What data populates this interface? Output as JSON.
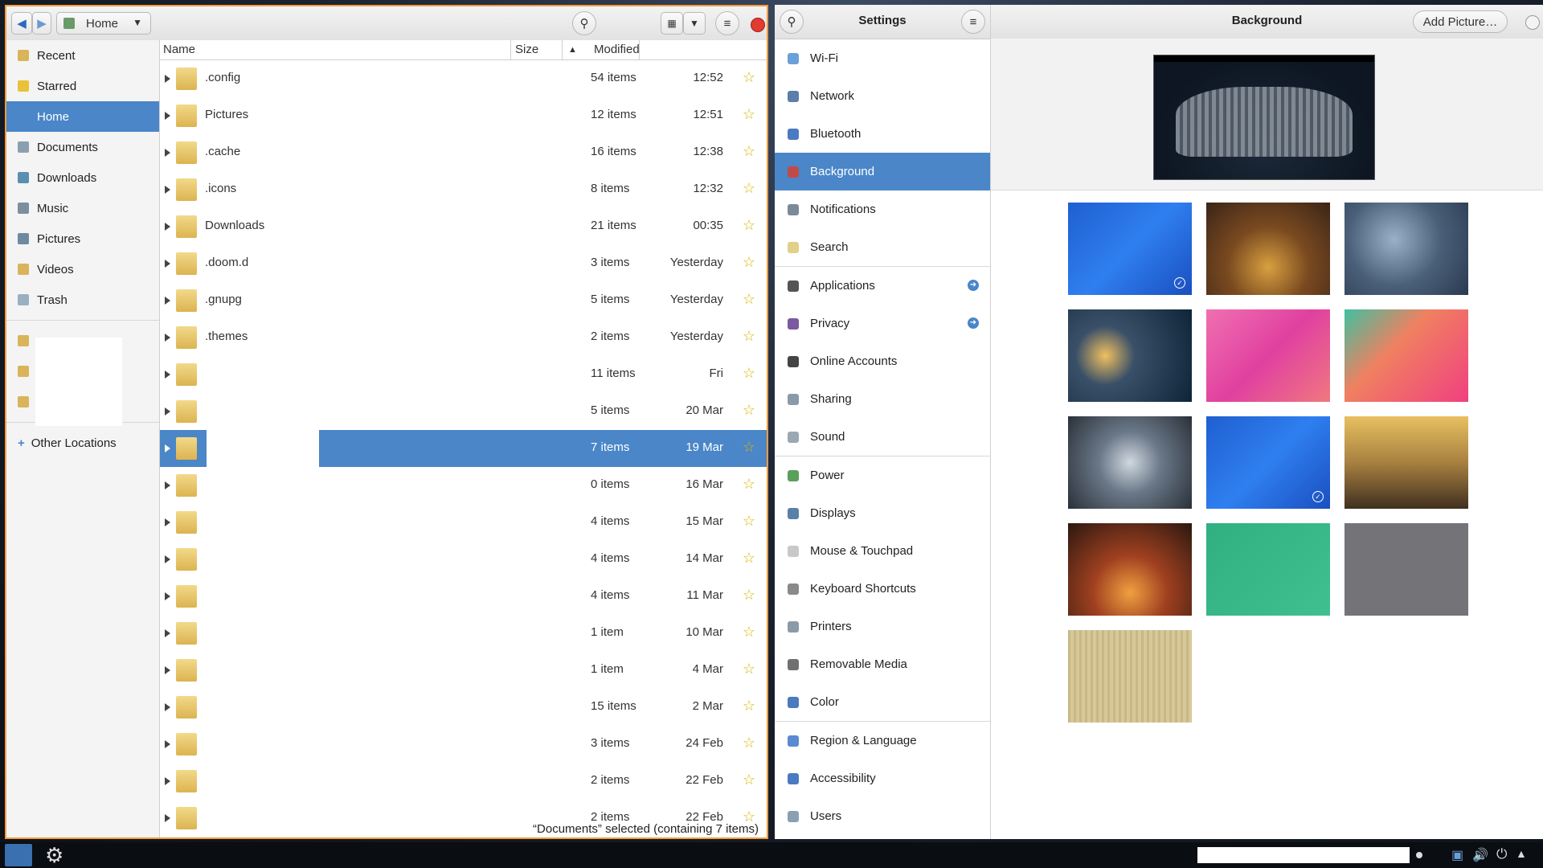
{
  "files": {
    "location": "Home",
    "columns": {
      "name": "Name",
      "size": "Size",
      "modified": "Modified"
    },
    "sidebar": [
      {
        "label": "Recent",
        "color": "#d9b45a"
      },
      {
        "label": "Starred",
        "color": "#e8c23a"
      },
      {
        "label": "Home",
        "color": "#4a86c8",
        "selected": true
      },
      {
        "label": "Documents",
        "color": "#8aa0b0"
      },
      {
        "label": "Downloads",
        "color": "#5a8fb0"
      },
      {
        "label": "Music",
        "color": "#7a8f9f"
      },
      {
        "label": "Pictures",
        "color": "#6f8aa0"
      },
      {
        "label": "Videos",
        "color": "#d9b45a"
      },
      {
        "label": "Trash",
        "color": "#9ab0c0"
      }
    ],
    "other_locations": "Other Locations",
    "rows": [
      {
        "name": ".config",
        "size": "54 items",
        "modified": "12:52"
      },
      {
        "name": "Pictures",
        "size": "12 items",
        "modified": "12:51"
      },
      {
        "name": ".cache",
        "size": "16 items",
        "modified": "12:38"
      },
      {
        "name": ".icons",
        "size": "8 items",
        "modified": "12:32"
      },
      {
        "name": "Downloads",
        "size": "21 items",
        "modified": "00:35"
      },
      {
        "name": ".doom.d",
        "size": "3 items",
        "modified": "Yesterday"
      },
      {
        "name": ".gnupg",
        "size": "5 items",
        "modified": "Yesterday"
      },
      {
        "name": ".themes",
        "size": "2 items",
        "modified": "Yesterday"
      },
      {
        "name": "",
        "size": "11 items",
        "modified": "Fri"
      },
      {
        "name": "",
        "size": "5 items",
        "modified": "20 Mar"
      },
      {
        "name": "",
        "size": "7 items",
        "modified": "19 Mar",
        "selected": true
      },
      {
        "name": "",
        "size": "0 items",
        "modified": "16 Mar"
      },
      {
        "name": "",
        "size": "4 items",
        "modified": "15 Mar"
      },
      {
        "name": "",
        "size": "4 items",
        "modified": "14 Mar"
      },
      {
        "name": "",
        "size": "4 items",
        "modified": "11 Mar"
      },
      {
        "name": "",
        "size": "1 item",
        "modified": "10 Mar"
      },
      {
        "name": "",
        "size": "1 item",
        "modified": "4 Mar"
      },
      {
        "name": "",
        "size": "15 items",
        "modified": "2 Mar"
      },
      {
        "name": "",
        "size": "3 items",
        "modified": "24 Feb"
      },
      {
        "name": "",
        "size": "2 items",
        "modified": "22 Feb"
      },
      {
        "name": "",
        "size": "2 items",
        "modified": "22 Feb"
      }
    ],
    "status": "“Documents” selected (containing 7 items)"
  },
  "settings": {
    "title": "Settings",
    "panel_title": "Background",
    "add_picture": "Add Picture…",
    "items": [
      {
        "label": "Wi-Fi",
        "color": "#6aa0d8"
      },
      {
        "label": "Network",
        "color": "#5a7fa8"
      },
      {
        "label": "Bluetooth",
        "color": "#4a7ac0"
      },
      {
        "label": "Background",
        "color": "#c04a4a",
        "selected": true
      },
      {
        "label": "Notifications",
        "color": "#7a8a9a"
      },
      {
        "label": "Search",
        "color": "#e0d08a"
      },
      {
        "label": "Applications",
        "color": "#555555",
        "arrow": true
      },
      {
        "label": "Privacy",
        "color": "#7a5aa0",
        "arrow": true
      },
      {
        "label": "Online Accounts",
        "color": "#444444"
      },
      {
        "label": "Sharing",
        "color": "#8a9aa8"
      },
      {
        "label": "Sound",
        "color": "#9aa8b4"
      },
      {
        "label": "Power",
        "color": "#5aa05a"
      },
      {
        "label": "Displays",
        "color": "#5a80a8"
      },
      {
        "label": "Mouse & Touchpad",
        "color": "#c8c8c8"
      },
      {
        "label": "Keyboard Shortcuts",
        "color": "#8a8a8a"
      },
      {
        "label": "Printers",
        "color": "#8a9aa8"
      },
      {
        "label": "Removable Media",
        "color": "#707070"
      },
      {
        "label": "Color",
        "color": "#4a7ac0"
      },
      {
        "label": "Region & Language",
        "color": "#5a8ad0"
      },
      {
        "label": "Accessibility",
        "color": "#4a7ac0"
      },
      {
        "label": "Users",
        "color": "#8aa0b0"
      }
    ],
    "wallpapers": [
      {
        "name": "blue-geometric",
        "bg": "linear-gradient(135deg,#1f5fd0 0%,#2f7ff0 50%,#1a4fc0 100%)",
        "selected": true
      },
      {
        "name": "autumn-leaf",
        "bg": "radial-gradient(circle at 50% 70%,#d8a040 0%,#7a4a20 45%,#3a2418 100%)"
      },
      {
        "name": "snowy-forest",
        "bg": "radial-gradient(circle at 40% 40%,#9ab0c8 0%,#4a6078 50%,#2a3a50 100%)"
      },
      {
        "name": "light-bulb",
        "bg": "radial-gradient(circle at 30% 50%,#f0c060 0%,#3a5068 30%,#0e2438 100%)"
      },
      {
        "name": "pink-wave",
        "bg": "linear-gradient(135deg,#f070b0 0%,#e040a0 50%,#f07880 100%)"
      },
      {
        "name": "coral-shapes",
        "bg": "linear-gradient(135deg,#40c0a0 0%,#f08060 40%,#f04080 100%)"
      },
      {
        "name": "snowflake",
        "bg": "radial-gradient(circle at 50% 50%,#d0d8e0 0%,#6a7888 40%,#2a3038 100%)"
      },
      {
        "name": "blue-geometric-2",
        "bg": "linear-gradient(135deg,#1f5fd0 0%,#2f7ff0 50%,#1a4fc0 100%)",
        "selected": true
      },
      {
        "name": "golden-sky",
        "bg": "linear-gradient(#e8c060 0%,#a88040 50%,#403020 100%)"
      },
      {
        "name": "forest-path",
        "bg": "radial-gradient(circle at 50% 75%,#f0a040 0%,#a04020 40%,#2a1810 100%)"
      },
      {
        "name": "green-dots",
        "bg": "linear-gradient(135deg,#30b080 0%,#40c090 100%)"
      },
      {
        "name": "grey",
        "bg": "#737378"
      },
      {
        "name": "wood",
        "bg": "repeating-linear-gradient(90deg,#c8b888 0 3px,#d8c898 3px 7px)"
      }
    ]
  }
}
